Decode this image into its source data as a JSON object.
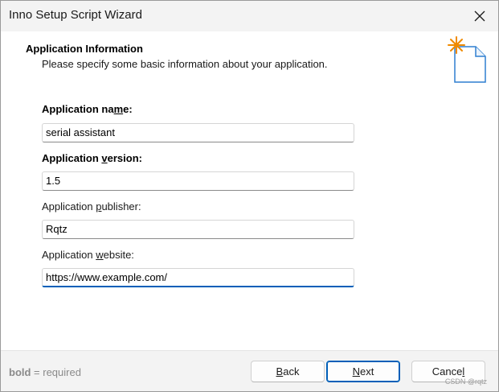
{
  "window": {
    "title": "Inno Setup Script Wizard"
  },
  "header": {
    "title": "Application Information",
    "subtitle": "Please specify some basic information about your application."
  },
  "form": {
    "app_name": {
      "label_pre": "Application na",
      "label_key": "m",
      "label_post": "e:",
      "value": "serial assistant",
      "required": true
    },
    "app_version": {
      "label_pre": "Application ",
      "label_key": "v",
      "label_post": "ersion:",
      "value": "1.5",
      "required": true
    },
    "app_publisher": {
      "label_pre": "Application ",
      "label_key": "p",
      "label_post": "ublisher:",
      "value": "Rqtz",
      "required": false
    },
    "app_website": {
      "label_pre": "Application ",
      "label_key": "w",
      "label_post": "ebsite:",
      "value": "https://www.example.com/",
      "required": false
    }
  },
  "footer": {
    "hint_bold": "bold",
    "hint_rest": " = required",
    "back": {
      "key": "B",
      "rest": "ack"
    },
    "next": {
      "key": "N",
      "rest": "ext"
    },
    "cancel": {
      "pre": "Cance",
      "key": "l",
      "rest": ""
    },
    "watermark": "CSDN @rqtz"
  },
  "colors": {
    "accent": "#005fb8",
    "titlebar_bg": "#f3f3f3",
    "footer_bg": "#f3f3f3",
    "icon_star": "#f08a00",
    "icon_page": "#2f7fd0"
  },
  "icons": {
    "close": "close-icon",
    "wizard": "new-document-icon"
  }
}
